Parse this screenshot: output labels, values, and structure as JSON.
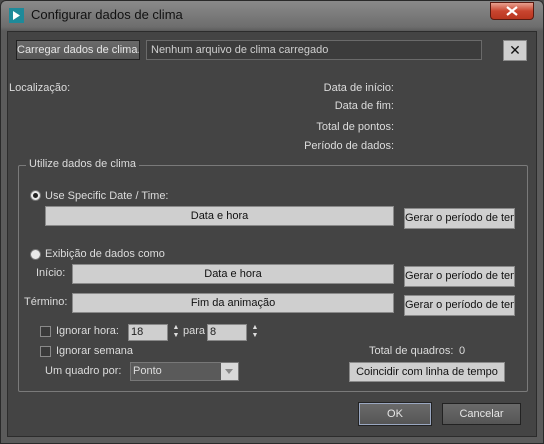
{
  "window": {
    "title": "Configurar dados de clima"
  },
  "file": {
    "load_label": "Carregar dados de clima...",
    "status": "Nenhum arquivo de clima carregado",
    "clear_symbol": "✕"
  },
  "info": {
    "location_label": "Localização:",
    "start_date_label": "Data de início:",
    "end_date_label": "Data de fim:",
    "total_points_label": "Total de pontos:",
    "data_period_label": "Período de dados:"
  },
  "group": {
    "title": "Utilize dados de clima",
    "specific_radio_label": "Use Specific Date / Time:",
    "specific_radio_checked": true,
    "specific_date_value": "Data e hora",
    "specific_range_button": "Gerar o período de tempo",
    "display_radio_label": "Exibição de dados como",
    "display_radio_checked": false,
    "start_label": "Início:",
    "start_value": "Data e hora",
    "start_range_button": "Gerar o período de tempo",
    "end_label": "Término:",
    "end_value": "Fim da animação",
    "end_range_button": "Gerar o período de tempo",
    "ignore_hours_label": "Ignorar hora:",
    "ignore_hours_from": "18",
    "to_label": "para",
    "ignore_hours_to": "8",
    "ignore_week_label": "Ignorar semana",
    "frame_per_label": "Um quadro por:",
    "frame_per_value": "Ponto",
    "total_frames_label": "Total de quadros:",
    "total_frames_value": "0",
    "match_timeline_button": "Coincidir com linha de tempo"
  },
  "footer": {
    "ok_label": "OK",
    "cancel_label": "Cancelar"
  }
}
